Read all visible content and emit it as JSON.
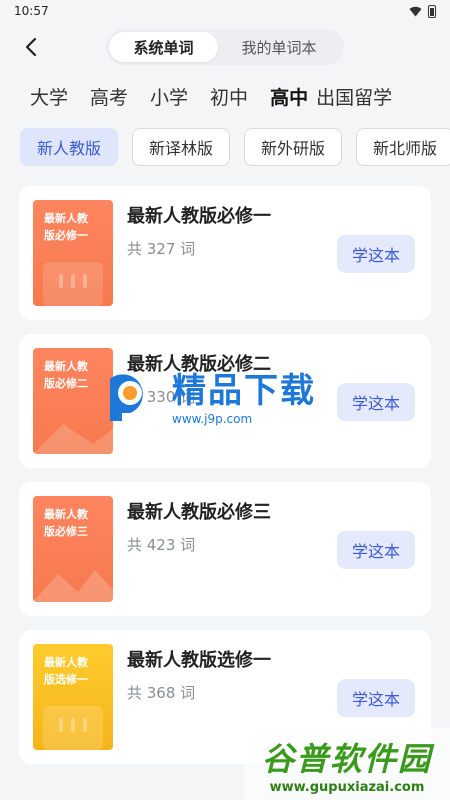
{
  "status": {
    "time": "10:57"
  },
  "header": {
    "tabs": [
      {
        "label": "系统单词",
        "active": true
      },
      {
        "label": "我的单词本",
        "active": false
      }
    ]
  },
  "categories": [
    {
      "label": "大学"
    },
    {
      "label": "高考"
    },
    {
      "label": "小学"
    },
    {
      "label": "初中"
    },
    {
      "label": "高中",
      "active": true
    },
    {
      "label": "出国留学"
    }
  ],
  "versions": [
    {
      "label": "新人教版",
      "active": true
    },
    {
      "label": "新译林版"
    },
    {
      "label": "新外研版"
    },
    {
      "label": "新北师版"
    }
  ],
  "books": [
    {
      "cover_line1": "最新人教",
      "cover_line2": "版必修一",
      "title": "最新人教版必修一",
      "count": "共 327 词",
      "button": "学这本",
      "color": "orange"
    },
    {
      "cover_line1": "最新人教",
      "cover_line2": "版必修二",
      "title": "最新人教版必修二",
      "count": "共 330 词",
      "button": "学这本",
      "color": "orange"
    },
    {
      "cover_line1": "最新人教",
      "cover_line2": "版必修三",
      "title": "最新人教版必修三",
      "count": "共 423 词",
      "button": "学这本",
      "color": "orange"
    },
    {
      "cover_line1": "最新人教",
      "cover_line2": "版选修一",
      "title": "最新人教版选修一",
      "count": "共 368 词",
      "button": "学这本",
      "color": "yellow"
    }
  ],
  "watermarks": {
    "center_title": "精品下载",
    "center_url": "www.j9p.com",
    "corner_title": "谷普软件园",
    "corner_url": "www.gupuxiazai.com"
  },
  "colors": {
    "accent": "#3b5bd6",
    "chip_active_bg": "#dfe6fb",
    "cover_orange": "#f57a4e",
    "cover_yellow": "#f5b51a"
  }
}
